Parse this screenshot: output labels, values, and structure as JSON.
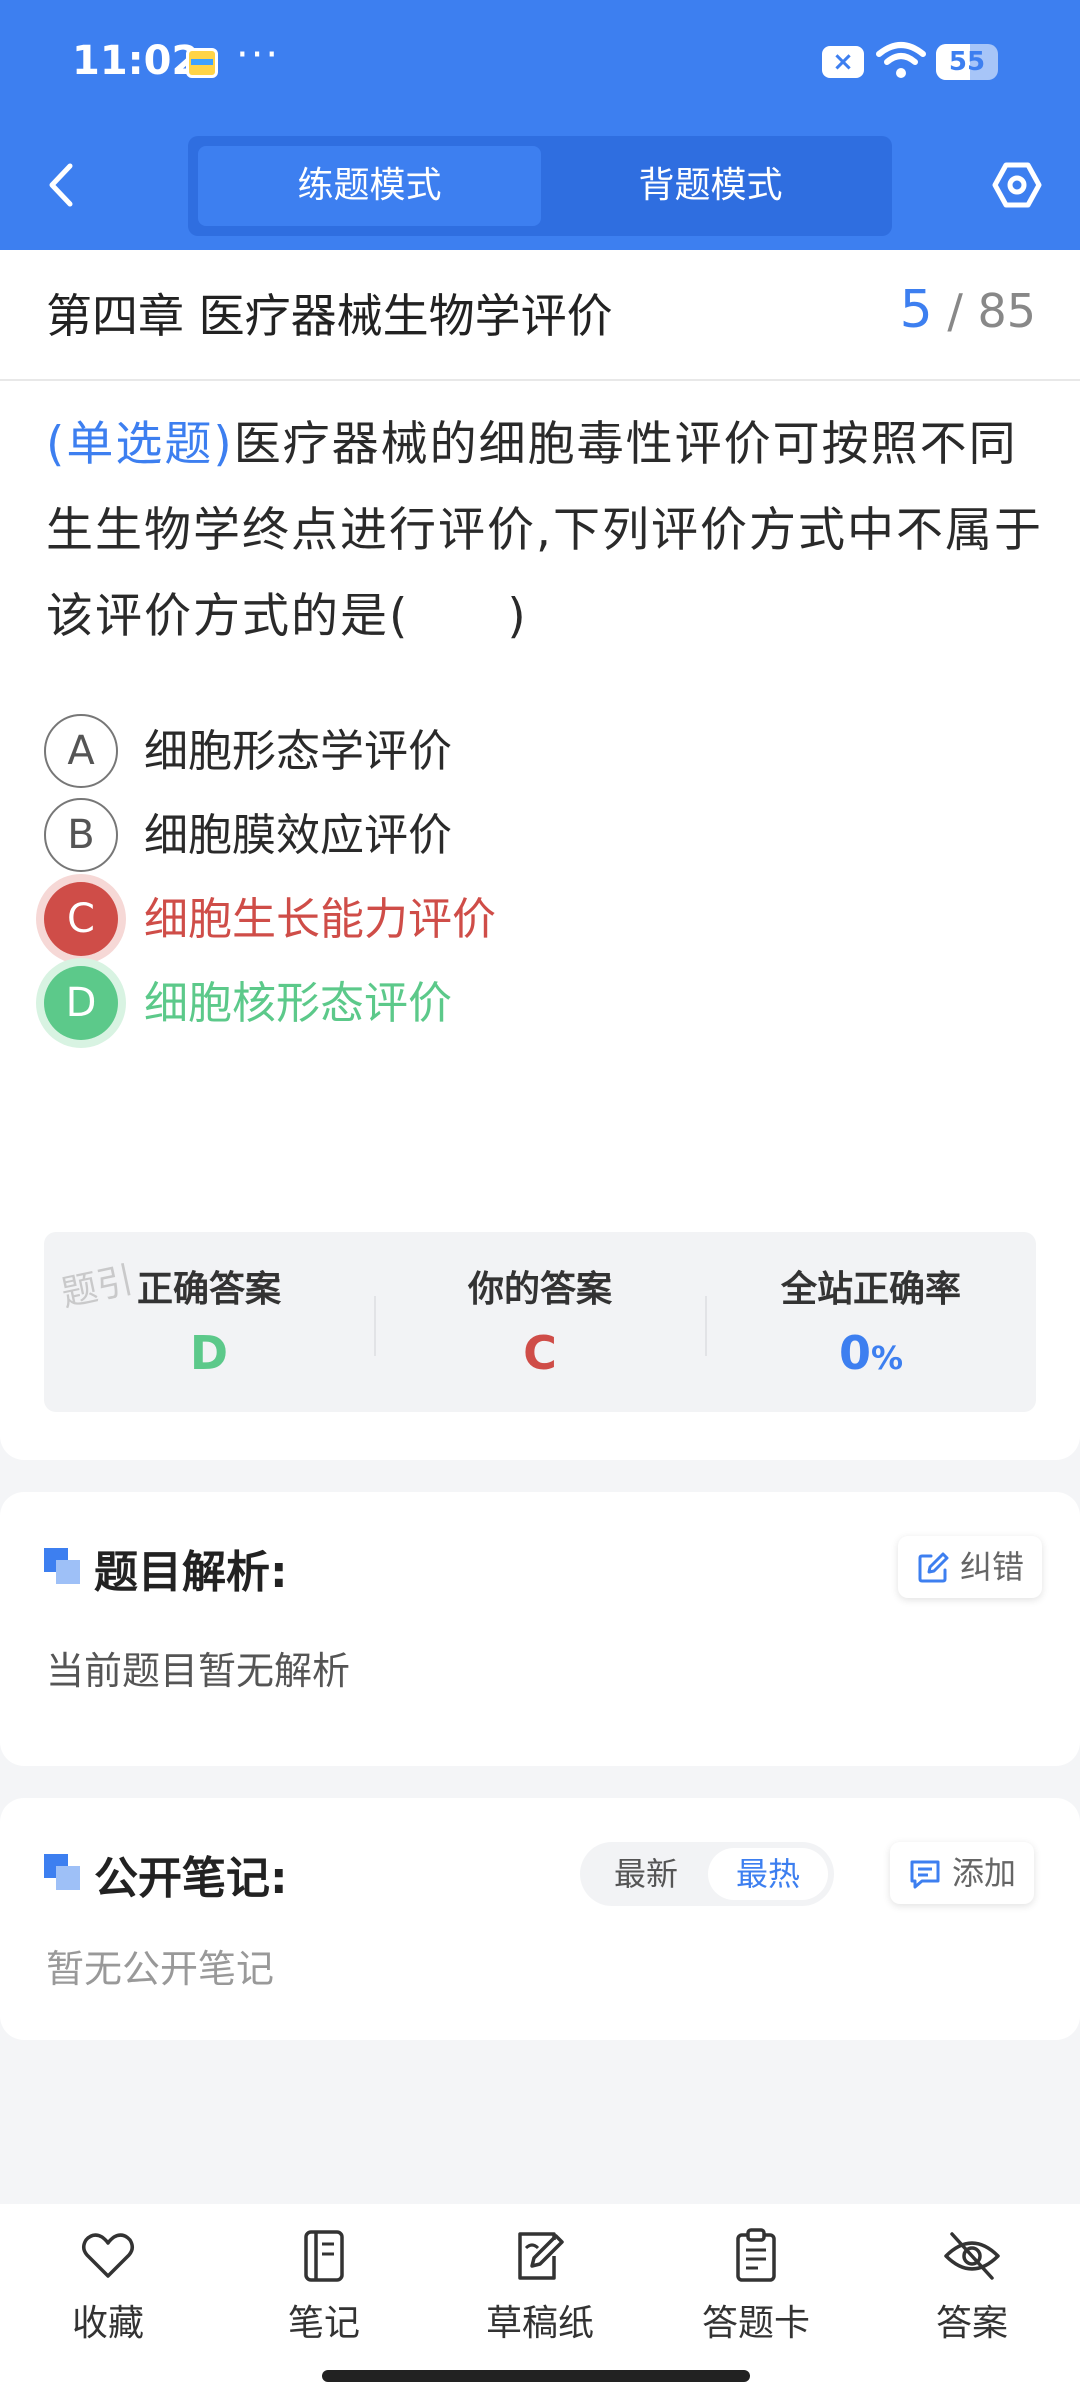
{
  "status_bar": {
    "time": "11:02",
    "dots": "···",
    "battery": "55",
    "battery_level": 0.55
  },
  "header": {
    "tabs": [
      "练题模式",
      "背题模式"
    ],
    "active_tab": 0
  },
  "question": {
    "chapter": "第四章 医疗器械生物学评价",
    "current": "5",
    "separator": "/",
    "total": "85",
    "type_label": "(单选题)",
    "text": "医疗器械的细胞毒性评价可按照不同生生物学终点进行评价,下列评价方式中不属于该评价方式的是(　　)",
    "options": [
      {
        "letter": "A",
        "text": "细胞形态学评价",
        "state": "normal"
      },
      {
        "letter": "B",
        "text": "细胞膜效应评价",
        "state": "normal"
      },
      {
        "letter": "C",
        "text": "细胞生长能力评价",
        "state": "wrong"
      },
      {
        "letter": "D",
        "text": "细胞核形态评价",
        "state": "correct"
      }
    ]
  },
  "summary": {
    "correct_label": "正确答案",
    "correct_value": "D",
    "yours_label": "你的答案",
    "yours_value": "C",
    "rate_label": "全站正确率",
    "rate_value": "0",
    "rate_unit": "%",
    "watermark": "题引"
  },
  "analysis": {
    "title": "题目解析:",
    "report_button": "纠错",
    "body": "当前题目暂无解析"
  },
  "notes": {
    "title": "公开笔记:",
    "sort_options": [
      "最新",
      "最热"
    ],
    "active_sort": 1,
    "add_button": "添加",
    "body": "暂无公开笔记"
  },
  "bottom_nav": [
    {
      "label": "收藏",
      "icon": "heart-icon"
    },
    {
      "label": "笔记",
      "icon": "notebook-icon"
    },
    {
      "label": "草稿纸",
      "icon": "draft-icon"
    },
    {
      "label": "答题卡",
      "icon": "answer-sheet-icon"
    },
    {
      "label": "答案",
      "icon": "eye-off-icon"
    }
  ],
  "colors": {
    "accent": "#3d7ff0",
    "wrong": "#cf4d48",
    "correct": "#5cc98a"
  }
}
